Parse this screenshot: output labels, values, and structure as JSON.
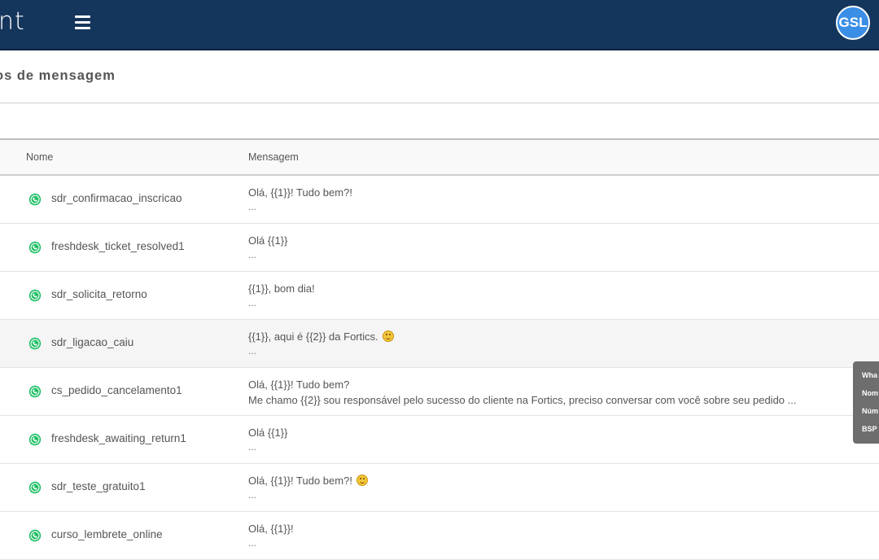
{
  "app": {
    "brand_text": "nt"
  },
  "header": {
    "avatar_initials": "GSL",
    "avatar_color": "#3a8ee6",
    "bar_color": "#15365c"
  },
  "page": {
    "title": "os de mensagem"
  },
  "table": {
    "columns": {
      "name": "Nome",
      "message": "Mensagem"
    },
    "rows": [
      {
        "name": "sdr_confirmacao_inscricao",
        "line1": "Olá, {{1}}! Tudo bem?!",
        "line2": "...",
        "emoji": false
      },
      {
        "name": "freshdesk_ticket_resolved1",
        "line1": "Olá {{1}}",
        "line2": "...",
        "emoji": false
      },
      {
        "name": "sdr_solicita_retorno",
        "line1": "{{1}}, bom dia!",
        "line2": "...",
        "emoji": false
      },
      {
        "name": "sdr_ligacao_caiu",
        "line1": "{{1}}, aqui é {{2}} da Fortics.",
        "line2": "...",
        "emoji": true
      },
      {
        "name": "cs_pedido_cancelamento1",
        "line1": "Olá, {{1}}! Tudo bem?",
        "line2": "Me chamo {{2}} sou responsável pelo sucesso do cliente na Fortics, preciso conversar com você sobre seu pedido ...",
        "emoji": false
      },
      {
        "name": "freshdesk_awaiting_return1",
        "line1": "Olá {{1}}",
        "line2": "...",
        "emoji": false
      },
      {
        "name": "sdr_teste_gratuito1",
        "line1": "Olá, {{1}}! Tudo bem?!",
        "line2": "...",
        "emoji": true
      },
      {
        "name": "curso_lembrete_online",
        "line1": "Olá, {{1}}!",
        "line2": "...",
        "emoji": false
      }
    ]
  },
  "tooltip": {
    "lines": [
      "Wha",
      "Nom",
      "Núm",
      "BSP"
    ]
  },
  "icons": {
    "row_icon": "whatsapp-icon",
    "row_icon_color": "#25c16a",
    "menu_icon": "hamburger-menu-icon"
  }
}
